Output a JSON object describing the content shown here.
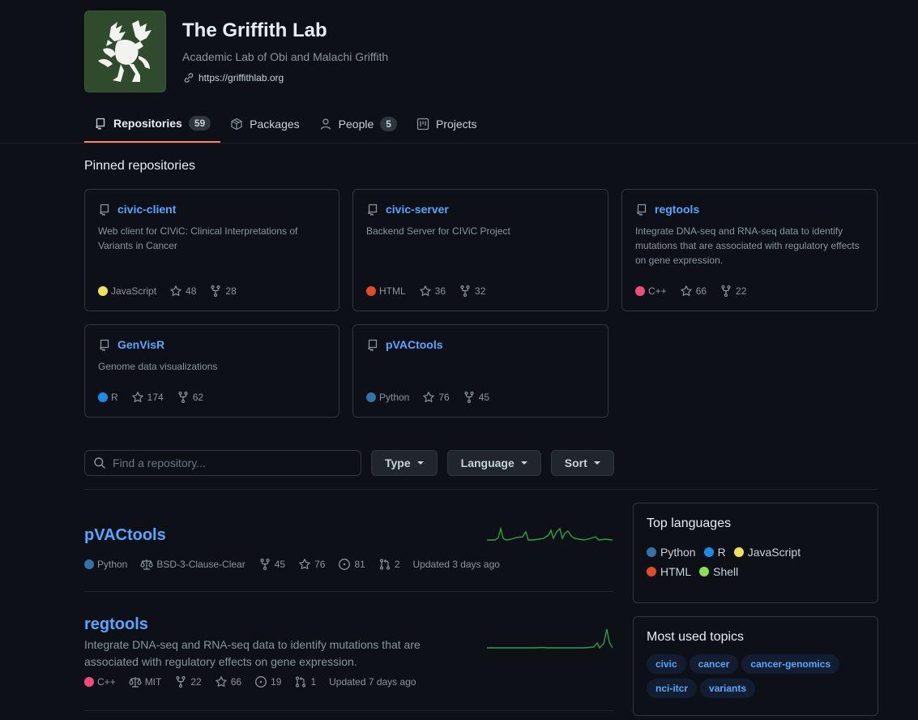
{
  "org": {
    "name": "The Griffith Lab",
    "description": "Academic Lab of Obi and Malachi Griffith",
    "url": "https://griffithlab.org"
  },
  "tabs": [
    {
      "label": "Repositories",
      "count": "59",
      "icon": "repo-icon"
    },
    {
      "label": "Packages",
      "icon": "package-icon"
    },
    {
      "label": "People",
      "count": "5",
      "icon": "person-icon"
    },
    {
      "label": "Projects",
      "icon": "project-icon"
    }
  ],
  "pinned": {
    "title": "Pinned repositories",
    "repos": [
      {
        "name": "civic-client",
        "description": "Web client for CIViC: Clinical Interpretations of Variants in Cancer",
        "language": "JavaScript",
        "language_color": "#f1e05a",
        "stars": "48",
        "forks": "28"
      },
      {
        "name": "civic-server",
        "description": "Backend Server for CIViC Project",
        "language": "HTML",
        "language_color": "#e34c26",
        "stars": "36",
        "forks": "32"
      },
      {
        "name": "regtools",
        "description": "Integrate DNA-seq and RNA-seq data to identify mutations that are associated with regulatory effects on gene expression.",
        "language": "C++",
        "language_color": "#f34b7d",
        "stars": "66",
        "forks": "22"
      },
      {
        "name": "GenVisR",
        "description": "Genome data visualizations",
        "language": "R",
        "language_color": "#198ce7",
        "stars": "174",
        "forks": "62"
      },
      {
        "name": "pVACtools",
        "description": "",
        "language": "Python",
        "language_color": "#3572a5",
        "stars": "76",
        "forks": "45"
      }
    ]
  },
  "filters": {
    "search_placeholder": "Find a repository...",
    "type_label": "Type",
    "language_label": "Language",
    "sort_label": "Sort"
  },
  "repos": [
    {
      "name": "pVACtools",
      "description": "",
      "language": "Python",
      "language_color": "#3572a5",
      "license": "BSD-3-Clause-Clear",
      "forks": "45",
      "stars": "76",
      "issues": "81",
      "pulls": "2",
      "updated": "Updated 3 days ago"
    },
    {
      "name": "regtools",
      "description": "Integrate DNA-seq and RNA-seq data to identify mutations that are associated with regulatory effects on gene expression.",
      "language": "C++",
      "language_color": "#f34b7d",
      "license": "MIT",
      "forks": "22",
      "stars": "66",
      "issues": "19",
      "pulls": "1",
      "updated": "Updated 7 days ago"
    }
  ],
  "sidebar": {
    "top_languages_title": "Top languages",
    "languages": [
      {
        "name": "Python",
        "color": "#3572a5"
      },
      {
        "name": "R",
        "color": "#198ce7"
      },
      {
        "name": "JavaScript",
        "color": "#f1e05a"
      },
      {
        "name": "HTML",
        "color": "#e34c26"
      },
      {
        "name": "Shell",
        "color": "#89e051"
      }
    ],
    "topics_title": "Most used topics",
    "topics": [
      "civic",
      "cancer",
      "cancer-genomics",
      "nci-itcr",
      "variants"
    ]
  }
}
